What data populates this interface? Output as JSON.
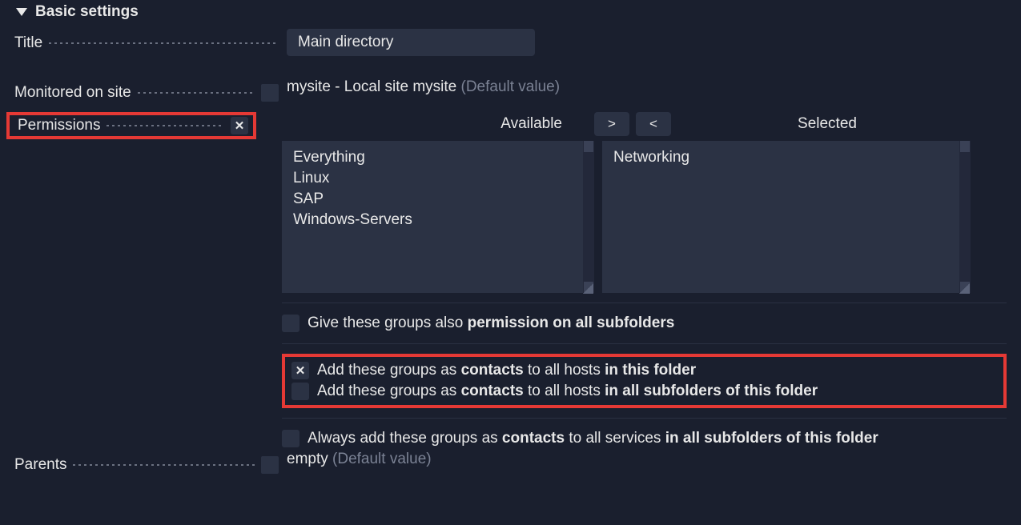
{
  "section_title": "Basic settings",
  "title": {
    "label": "Title",
    "value": "Main directory"
  },
  "monitored_on_site": {
    "label": "Monitored on site",
    "value_prefix": "mysite - Local site mysite ",
    "default_text": "(Default value)"
  },
  "permissions": {
    "label": "Permissions",
    "available_label": "Available",
    "selected_label": "Selected",
    "move_right": ">",
    "move_left": "<",
    "available_items": [
      "Everything",
      "Linux",
      "SAP",
      "Windows-Servers"
    ],
    "selected_items": [
      "Networking"
    ],
    "opt_subfolders_prefix": "Give these groups also ",
    "opt_subfolders_bold": "permission on all subfolders",
    "opt_contacts_this_prefix": "Add these groups as ",
    "opt_contacts_this_b1": "contacts",
    "opt_contacts_this_mid": " to all hosts ",
    "opt_contacts_this_b2": "in this folder",
    "opt_contacts_sub_prefix": "Add these groups as ",
    "opt_contacts_sub_b1": "contacts",
    "opt_contacts_sub_mid": " to all hosts ",
    "opt_contacts_sub_b2": "in all subfolders of this folder",
    "opt_services_prefix": "Always add these groups as ",
    "opt_services_b1": "contacts",
    "opt_services_mid": " to all services ",
    "opt_services_b2": "in all subfolders of this folder"
  },
  "parents": {
    "label": "Parents",
    "value": "empty ",
    "default_text": "(Default value)"
  }
}
